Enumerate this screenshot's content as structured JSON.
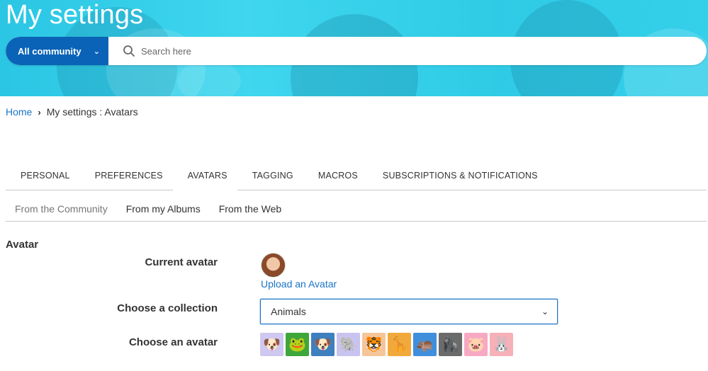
{
  "header": {
    "title": "My settings",
    "search": {
      "scope_label": "All community",
      "placeholder": "Search here"
    }
  },
  "breadcrumb": {
    "home": "Home",
    "current": "My settings : Avatars"
  },
  "tabs": [
    {
      "label": "PERSONAL"
    },
    {
      "label": "PREFERENCES"
    },
    {
      "label": "AVATARS"
    },
    {
      "label": "TAGGING"
    },
    {
      "label": "MACROS"
    },
    {
      "label": "SUBSCRIPTIONS & NOTIFICATIONS"
    }
  ],
  "active_tab": "AVATARS",
  "subtabs": [
    {
      "label": "From the Community"
    },
    {
      "label": "From my Albums"
    },
    {
      "label": "From the Web"
    }
  ],
  "avatar_section": {
    "heading": "Avatar",
    "current_label": "Current avatar",
    "upload_link": "Upload an Avatar",
    "collection_label": "Choose a collection",
    "collection_value": "Animals",
    "choose_label": "Choose an avatar",
    "avatars": [
      {
        "icon": "dog-icon",
        "glyph": "🐶",
        "bg": "#cfc8f0"
      },
      {
        "icon": "frog-icon",
        "glyph": "🐸",
        "bg": "#3fa63a"
      },
      {
        "icon": "bulldog-icon",
        "glyph": "🐶",
        "bg": "#3e7fbe"
      },
      {
        "icon": "elephant-icon",
        "glyph": "🐘",
        "bg": "#c9c3ef"
      },
      {
        "icon": "tiger-icon",
        "glyph": "🐯",
        "bg": "#f5c59a"
      },
      {
        "icon": "giraffe-icon",
        "glyph": "🦒",
        "bg": "#f2a93b"
      },
      {
        "icon": "hippo-icon",
        "glyph": "🦛",
        "bg": "#3f8fdc"
      },
      {
        "icon": "gorilla-icon",
        "glyph": "🦍",
        "bg": "#6b6b6b"
      },
      {
        "icon": "pig-icon",
        "glyph": "🐷",
        "bg": "#f7a9c4"
      },
      {
        "icon": "rabbit-icon",
        "glyph": "🐰",
        "bg": "#f6b0b7"
      }
    ]
  },
  "colors": {
    "banner": "#2bc6e4",
    "primary": "#0a63b7",
    "link": "#1a73c7"
  }
}
